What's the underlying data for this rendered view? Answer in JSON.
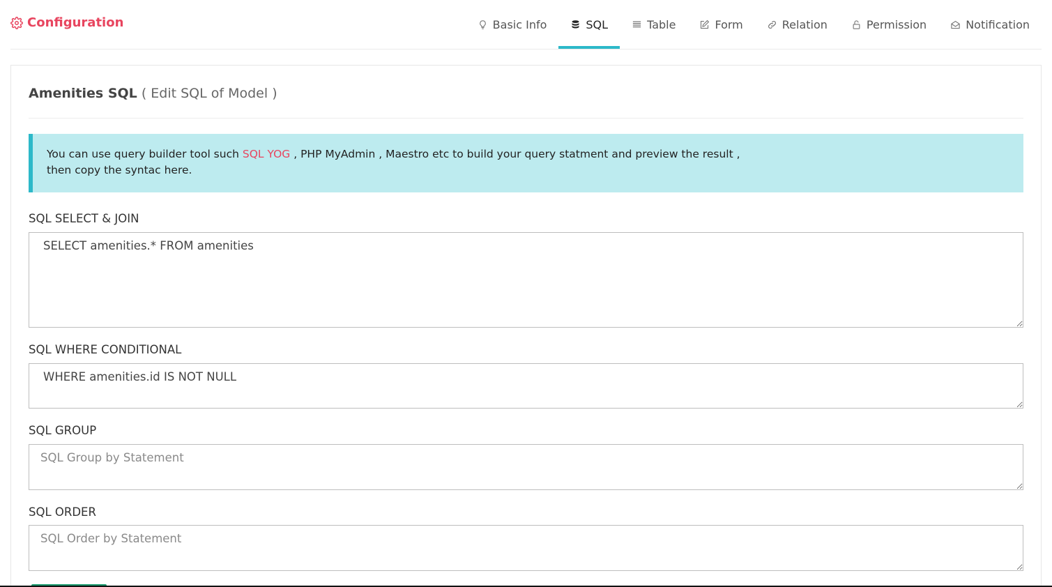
{
  "header": {
    "title": "Configuration",
    "tabs": [
      {
        "label": "Basic Info",
        "icon": "lightbulb-icon"
      },
      {
        "label": "SQL",
        "icon": "database-icon",
        "active": true
      },
      {
        "label": "Table",
        "icon": "list-icon"
      },
      {
        "label": "Form",
        "icon": "edit-icon"
      },
      {
        "label": "Relation",
        "icon": "link-icon"
      },
      {
        "label": "Permission",
        "icon": "lock-icon"
      },
      {
        "label": "Notification",
        "icon": "envelope-icon"
      }
    ]
  },
  "panel": {
    "title": "Amenities SQL",
    "subtitle": "( Edit SQL of Model )"
  },
  "alert": {
    "text_before": "You can use query builder tool such ",
    "highlight": "SQL YOG",
    "text_after": " , PHP MyAdmin , Maestro etc to build your query statment and preview the result ,",
    "line2": "then copy the syntac here."
  },
  "fields": {
    "select": {
      "label": "SQL SELECT & JOIN",
      "value": "SELECT amenities.* FROM amenities",
      "placeholder": ""
    },
    "where": {
      "label": "SQL WHERE CONDITIONAL",
      "value": "WHERE amenities.id IS NOT NULL",
      "placeholder": ""
    },
    "group": {
      "label": "SQL GROUP",
      "value": "",
      "placeholder": "SQL Group by Statement"
    },
    "order": {
      "label": "SQL ORDER",
      "value": "",
      "placeholder": "SQL Order by Statement"
    }
  },
  "colors": {
    "brand": "#e8455f",
    "accent": "#2db9c9",
    "alert_bg": "#bdebef",
    "save": "#1a9a6e"
  }
}
